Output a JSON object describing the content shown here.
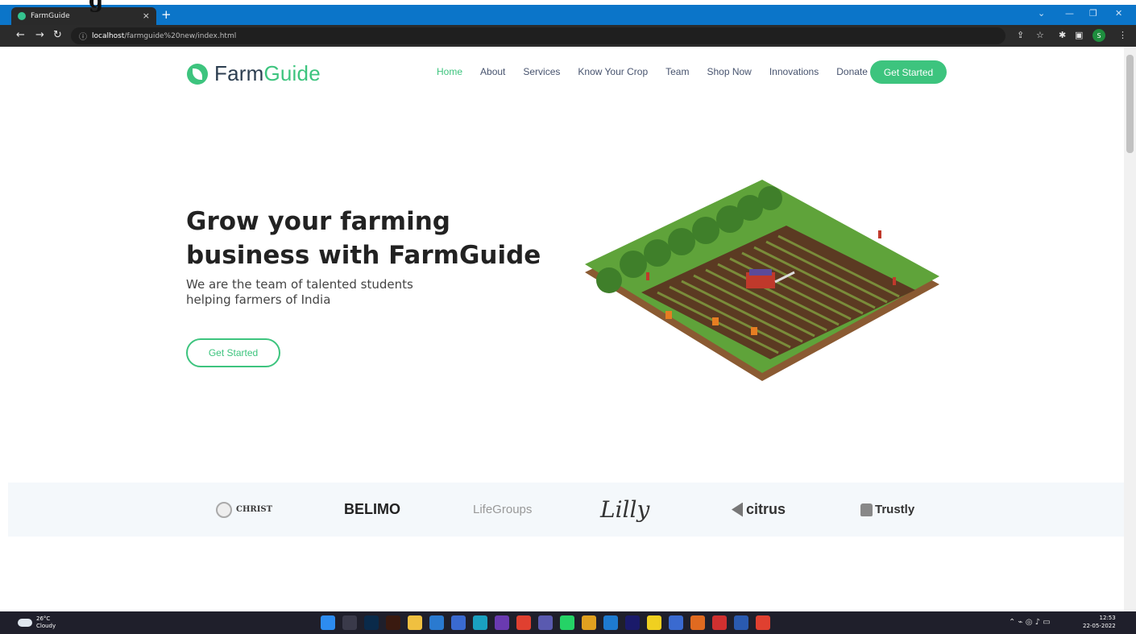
{
  "stray_text": "g",
  "browser": {
    "tab_title": "FarmGuide",
    "tab_close": "×",
    "new_tab": "+",
    "url_host": "localhost",
    "url_path": "/farmguide%20new/index.html",
    "profile_initial": "S"
  },
  "header": {
    "logo_part1": "Farm",
    "logo_part2": "Guide",
    "nav": [
      {
        "label": "Home",
        "active": true
      },
      {
        "label": "About"
      },
      {
        "label": "Services"
      },
      {
        "label": "Know Your Crop"
      },
      {
        "label": "Team"
      },
      {
        "label": "Shop Now"
      },
      {
        "label": "Innovations"
      },
      {
        "label": "Donate"
      }
    ],
    "cta": "Get Started"
  },
  "hero": {
    "title": "Grow your farming business with FarmGuide",
    "subtitle": "We are the team of talented students helping farmers of India",
    "button": "Get Started"
  },
  "clients": [
    "CHRIST",
    "BELIMO",
    "LifeGroups",
    "Lilly",
    "citrus",
    "Trustly"
  ],
  "taskbar": {
    "weather_temp": "26°C",
    "weather_desc": "Cloudy",
    "time": "12:53",
    "date": "22-05-2022"
  },
  "colors": {
    "accent": "#3dc47e",
    "tabbar": "#0b75c9",
    "clients_bg": "#f4f8fb"
  }
}
